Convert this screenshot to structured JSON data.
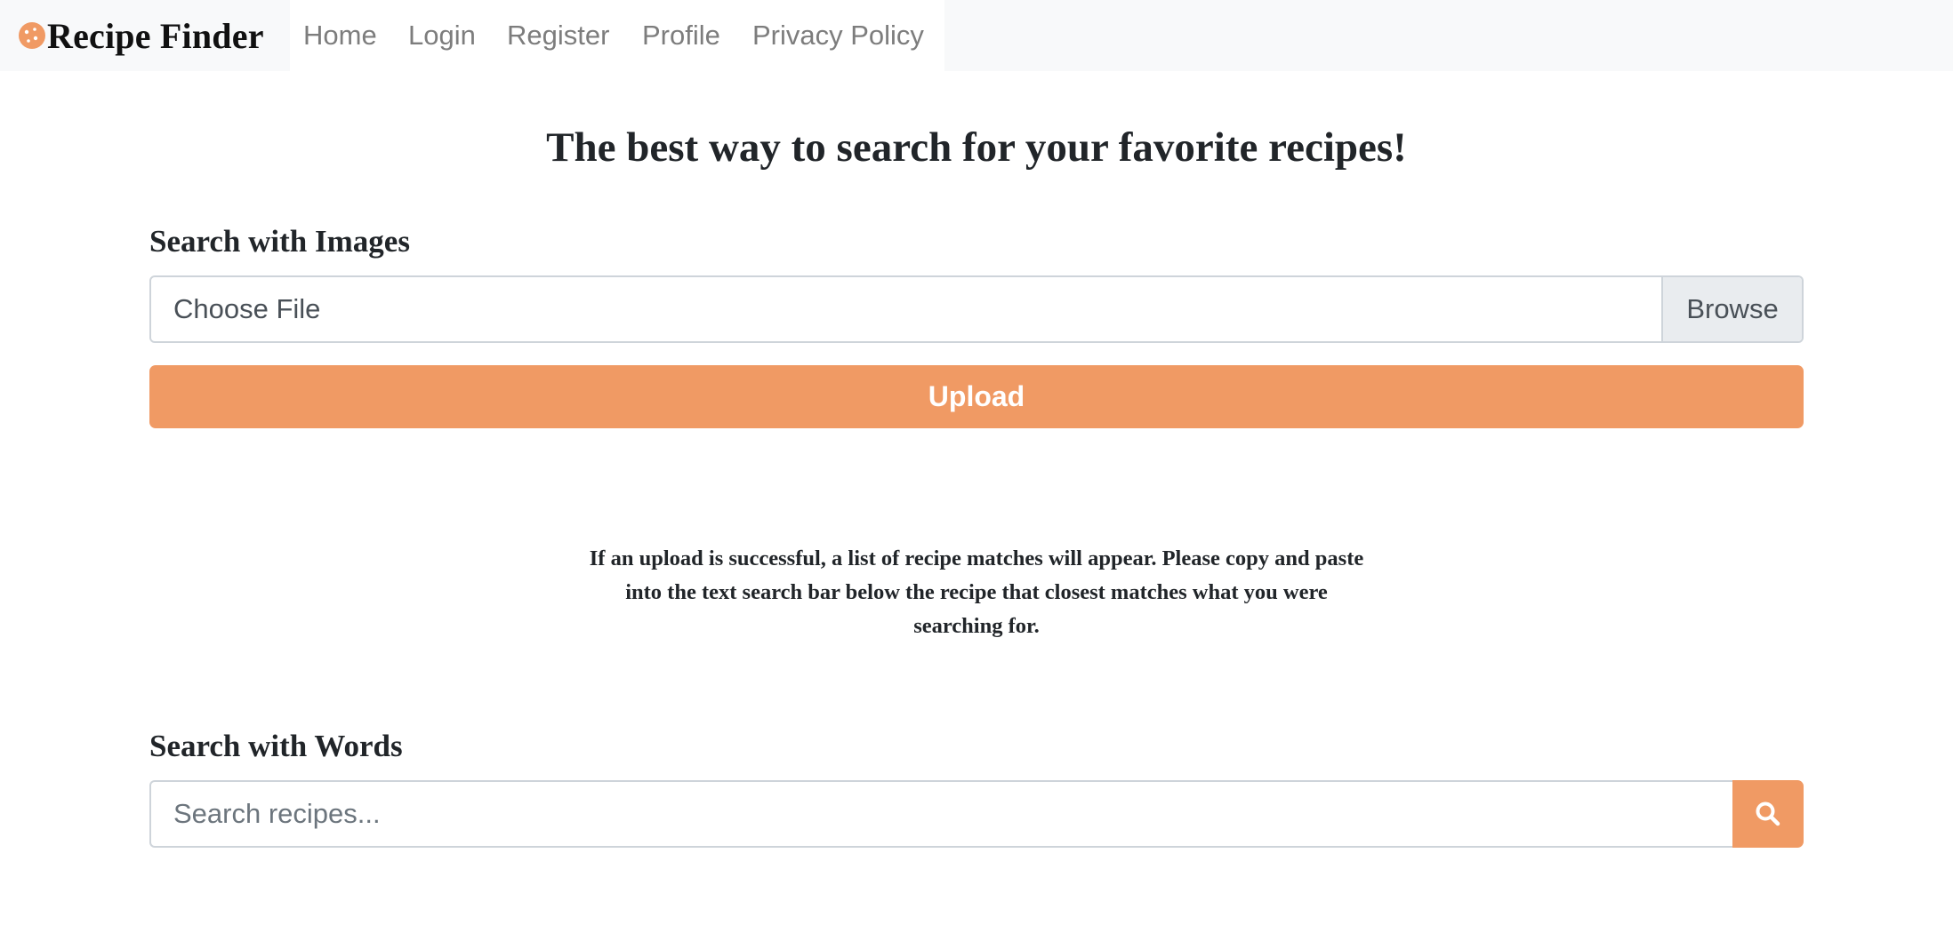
{
  "nav": {
    "brand": "Recipe Finder",
    "brand_icon": "cookie-icon",
    "links": [
      "Home",
      "Login",
      "Register",
      "Profile",
      "Privacy Policy"
    ]
  },
  "main": {
    "title": "The best way to search for your favorite recipes!",
    "image_search": {
      "heading": "Search with Images",
      "file_label": "Choose File",
      "browse_label": "Browse",
      "upload_label": "Upload"
    },
    "info": "If an upload is successful, a list of recipe matches will appear. Please copy and paste into the text search bar below the recipe that closest matches what you were searching for.",
    "word_search": {
      "heading": "Search with Words",
      "placeholder": "Search recipes...",
      "button_icon": "search-icon"
    }
  },
  "colors": {
    "accent": "#f09a64",
    "navbar_bg": "#f8f9fa",
    "nav_link": "#7d7d7d",
    "text": "#212529"
  }
}
